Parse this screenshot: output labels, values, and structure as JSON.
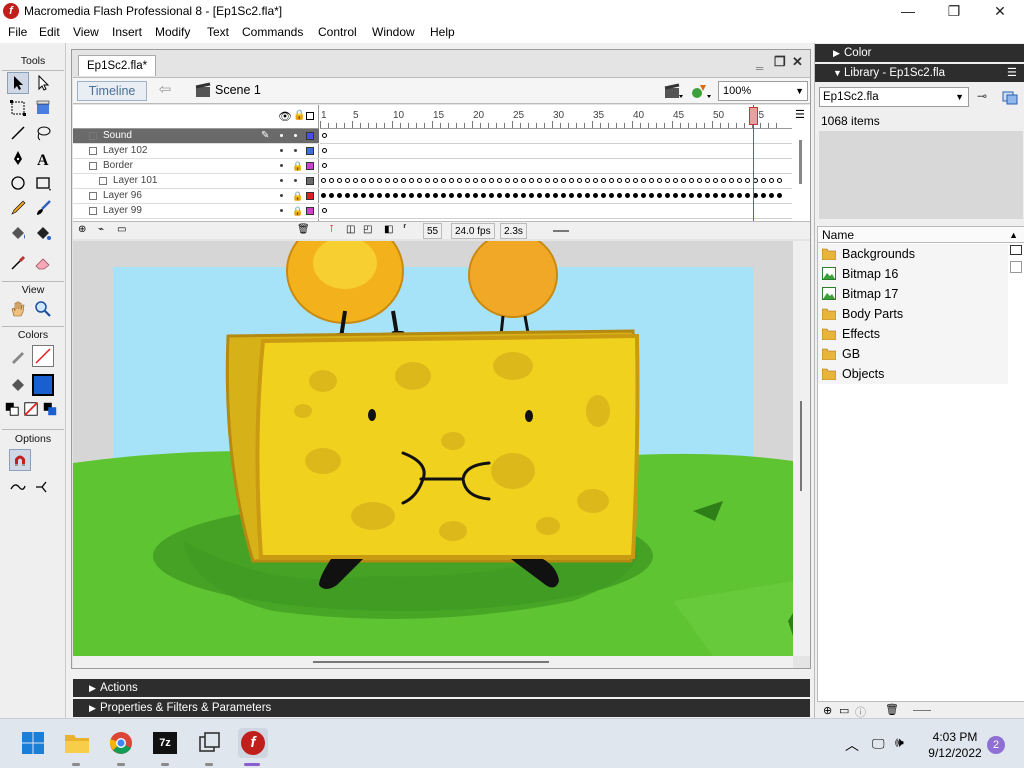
{
  "window": {
    "title": "Macromedia Flash Professional 8 - [Ep1Sc2.fla*]",
    "minimize": "—",
    "maximize": "❐",
    "close": "✕"
  },
  "menu": [
    "File",
    "Edit",
    "View",
    "Insert",
    "Modify",
    "Text",
    "Commands",
    "Control",
    "Window",
    "Help"
  ],
  "tools": {
    "title": "Tools",
    "view_label": "View",
    "colors_label": "Colors",
    "options_label": "Options"
  },
  "document": {
    "tab": "Ep1Sc2.fla*",
    "timeline_button": "Timeline",
    "scene": "Scene 1",
    "zoom": "100%"
  },
  "timeline": {
    "ruler_numbers": [
      "1",
      "5",
      "10",
      "15",
      "20",
      "25",
      "30",
      "35",
      "40",
      "45",
      "50",
      "55"
    ],
    "layers": [
      {
        "name": "Sound",
        "selected": true,
        "color": "#4a4aff"
      },
      {
        "name": "Layer 102",
        "selected": false,
        "color": "#3e6fe0"
      },
      {
        "name": "Border",
        "selected": false,
        "color": "#d040d0"
      },
      {
        "name": "Layer 101",
        "selected": false,
        "color": "#6a6a6a"
      },
      {
        "name": "Layer 96",
        "selected": false,
        "color": "#e02020"
      },
      {
        "name": "Layer 99",
        "selected": false,
        "color": "#d040d0"
      }
    ],
    "current_frame": "55",
    "fps": "24.0 fps",
    "elapsed": "2.3s"
  },
  "panels": {
    "actions": "Actions",
    "properties": "Properties & Filters & Parameters",
    "color": "Color",
    "library": "Library - Ep1Sc2.fla"
  },
  "library": {
    "selected_doc": "Ep1Sc2.fla",
    "items_count": "1068 items",
    "column_name": "Name",
    "items": [
      {
        "name": "Backgrounds",
        "type": "folder"
      },
      {
        "name": "Bitmap 16",
        "type": "bitmap"
      },
      {
        "name": "Bitmap 17",
        "type": "bitmap"
      },
      {
        "name": "Body Parts",
        "type": "folder"
      },
      {
        "name": "Effects",
        "type": "folder"
      },
      {
        "name": "GB",
        "type": "folder"
      },
      {
        "name": "Objects",
        "type": "folder"
      }
    ]
  },
  "taskbar": {
    "time": "4:03 PM",
    "date": "9/12/2022",
    "notifications": "2",
    "apps": [
      "windows-start-icon",
      "file-explorer-icon",
      "chrome-icon",
      "7zip-icon",
      "task-view-icon",
      "flash-icon"
    ]
  },
  "colors": {
    "sky": "#a7e3f8",
    "grass": "#5ec431",
    "sponge": "#f0d21e",
    "sponge_outline": "#c99a12",
    "accent_red": "#c0201c",
    "panel_dark": "#2d2d2d"
  }
}
